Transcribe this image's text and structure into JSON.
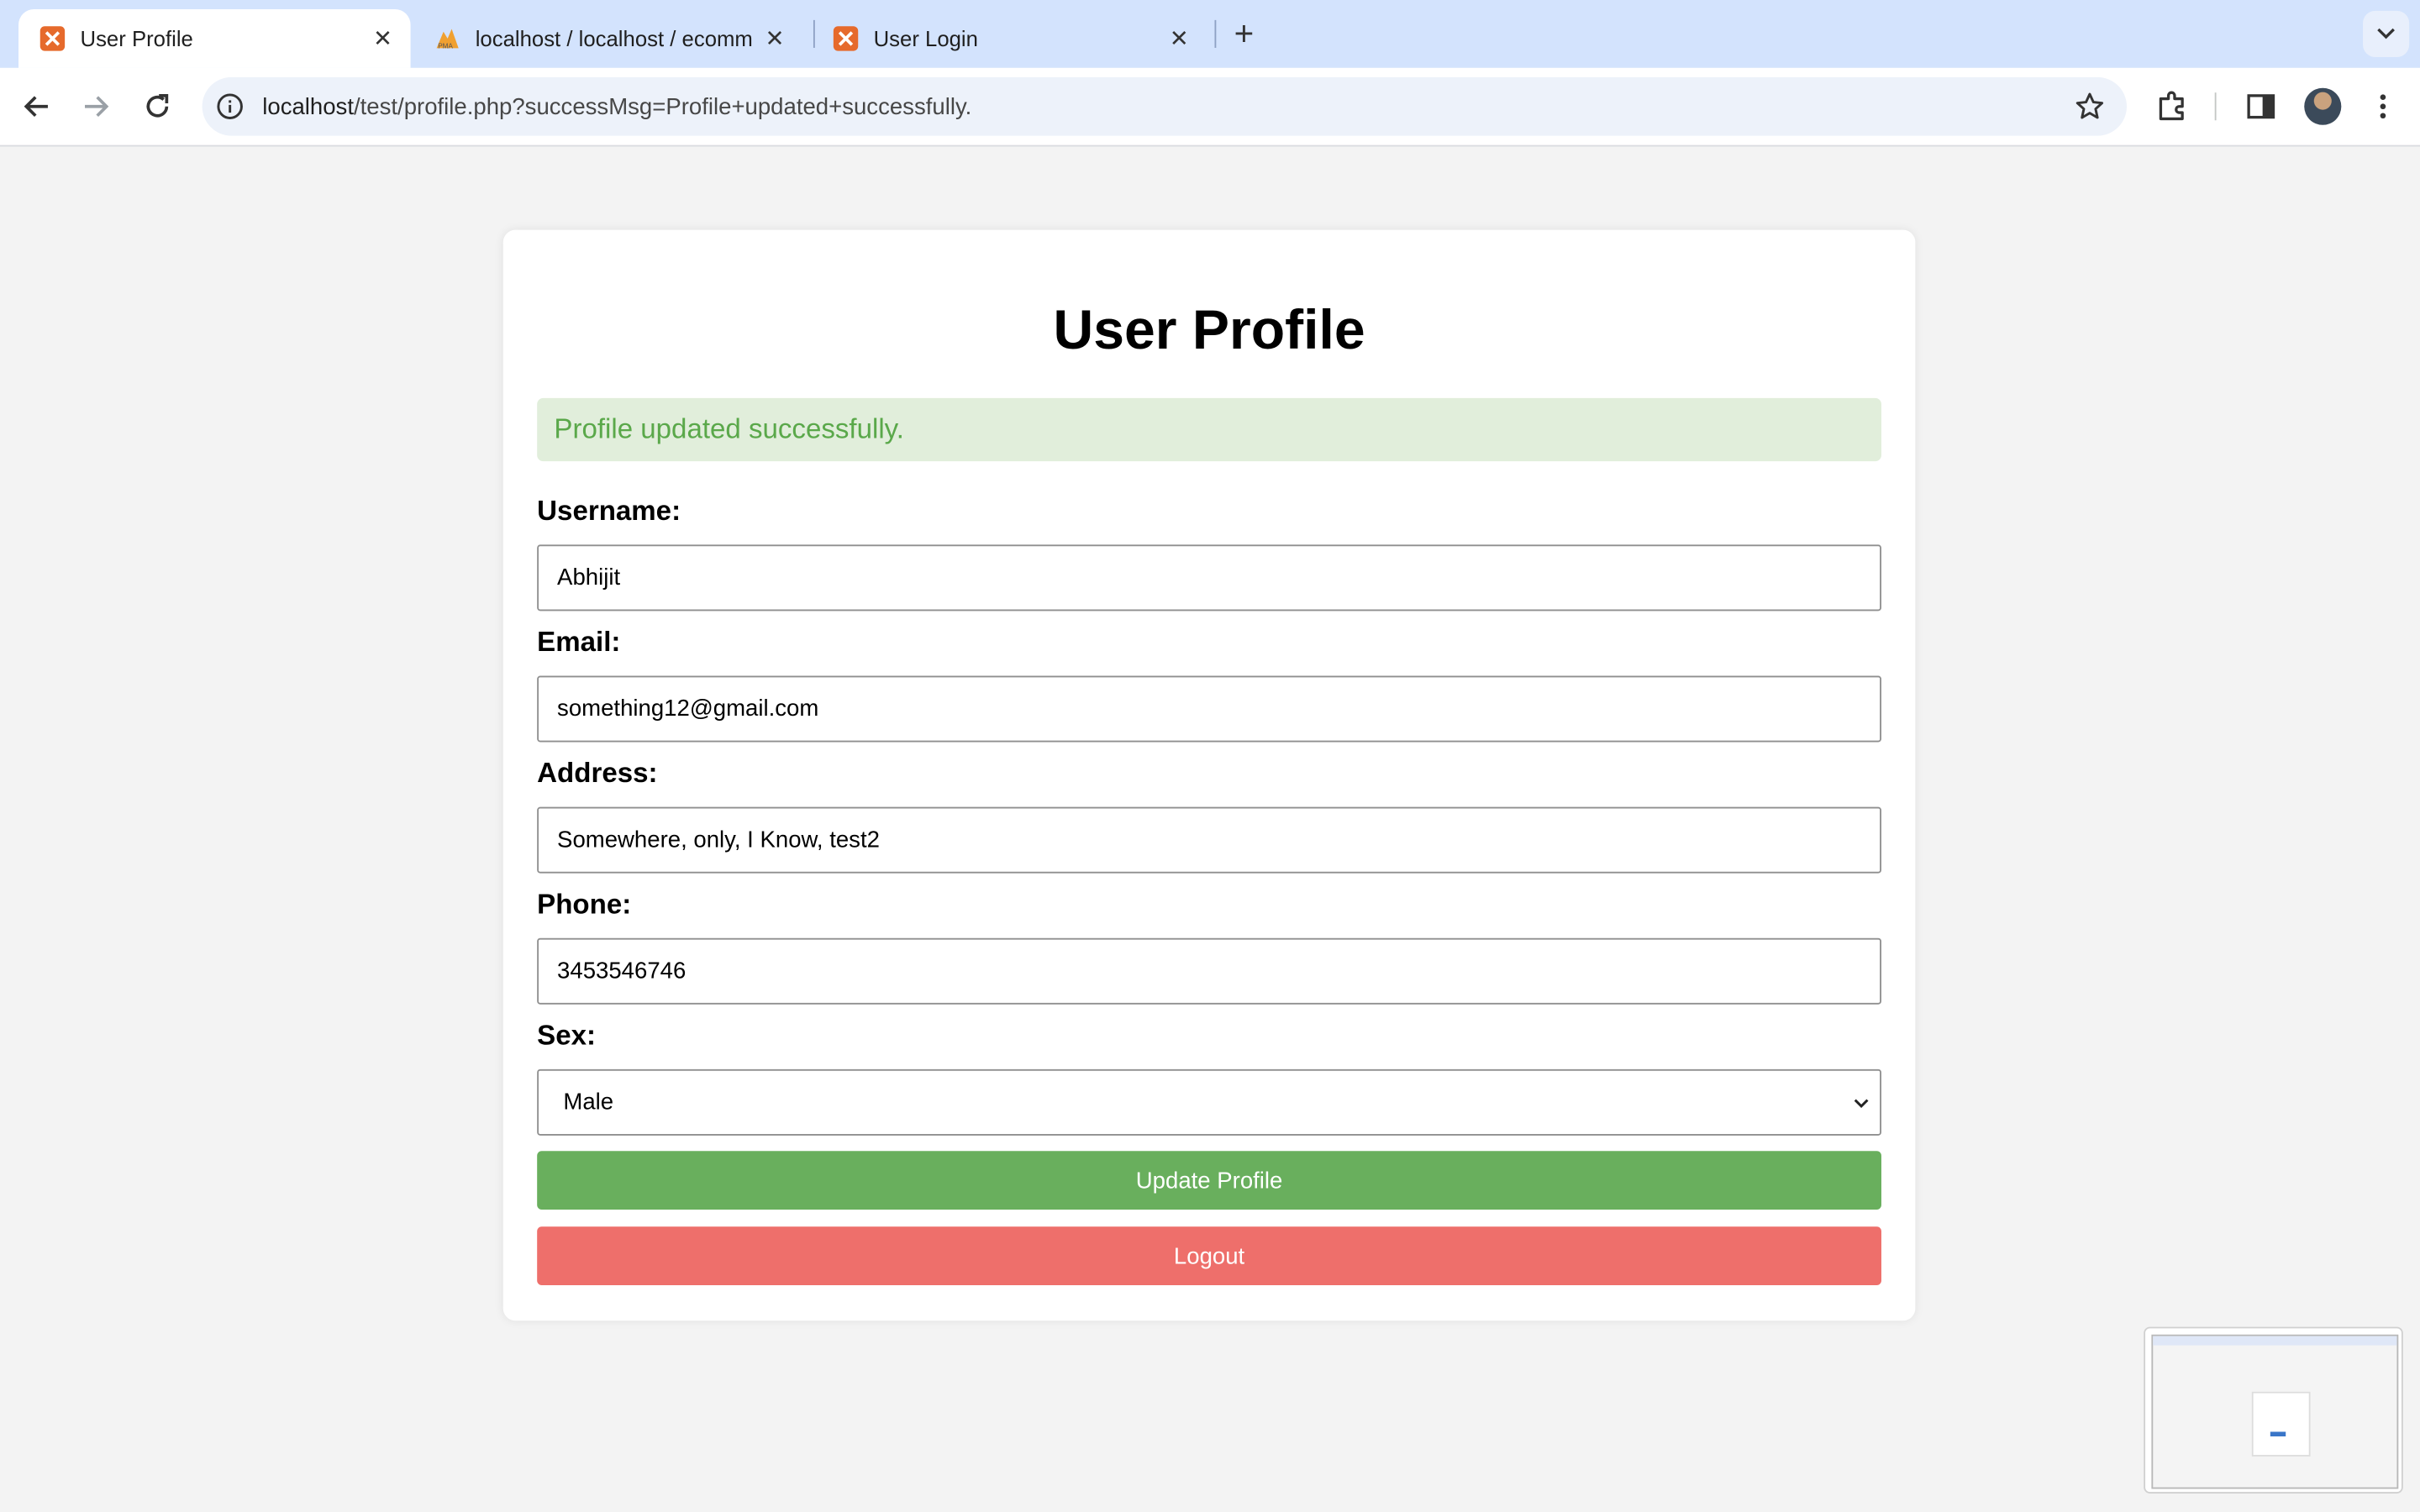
{
  "browser": {
    "tabs": [
      {
        "title": "User Profile",
        "active": true,
        "favicon": "xampp-icon"
      },
      {
        "title": "localhost / localhost / ecomm",
        "active": false,
        "favicon": "phpmyadmin-icon"
      },
      {
        "title": "User Login",
        "active": false,
        "favicon": "xampp-icon"
      }
    ],
    "url_host": "localhost",
    "url_path": "/test/profile.php?successMsg=Profile+updated+successfully."
  },
  "page": {
    "title": "User Profile",
    "success_message": "Profile updated successfully.",
    "fields": {
      "username": {
        "label": "Username:",
        "value": "Abhijit"
      },
      "email": {
        "label": "Email:",
        "value": "something12@gmail.com"
      },
      "address": {
        "label": "Address:",
        "value": "Somewhere, only, I Know, test2"
      },
      "phone": {
        "label": "Phone:",
        "value": "3453546746"
      },
      "sex": {
        "label": "Sex:",
        "value": "Male"
      }
    },
    "update_button": "Update Profile",
    "logout_button": "Logout"
  },
  "colors": {
    "success_bg": "#e1eedb",
    "success_text": "#5aa84a",
    "update_button": "#69af5d",
    "logout_button": "#ee6f6b"
  }
}
